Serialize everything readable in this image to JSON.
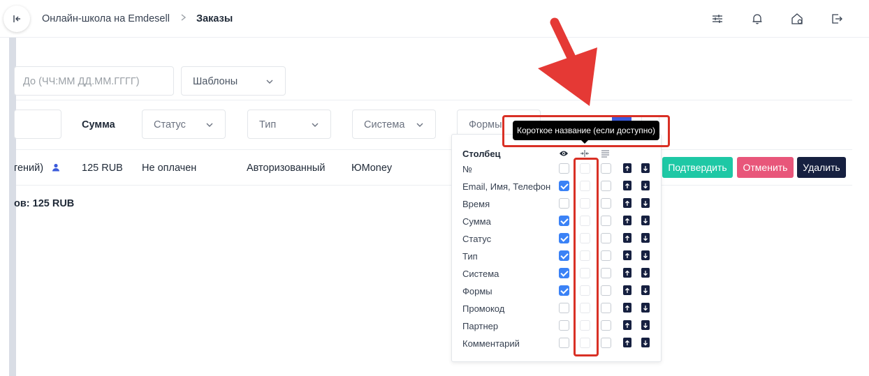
{
  "header": {
    "breadcrumb_root": "Онлайн-школа на Emdesell",
    "breadcrumb_current": "Заказы"
  },
  "filters": {
    "to_placeholder": "До (ЧЧ:ММ ДД.ММ.ГГГГ)",
    "templates_label": "Шаблоны"
  },
  "columns": {
    "sum": "Сумма",
    "status": "Статус",
    "type": "Тип",
    "system": "Система",
    "forms": "Формы"
  },
  "order_row": {
    "name_fragment": "гений)",
    "sum": "125 RUB",
    "status": "Не оплачен",
    "type": "Авторизованный",
    "system": "ЮMoney"
  },
  "actions": {
    "confirm": "Подтвердить",
    "cancel": "Отменить",
    "delete": "Удалить"
  },
  "colors": {
    "confirm": "#1ec8a5",
    "cancel": "#e8567a",
    "delete": "#162040",
    "checkbox_on": "#3b82f6",
    "annotation": "#d93025"
  },
  "total_text": "ов: 125 RUB",
  "tooltip_text": "Короткое название (если доступно)",
  "column_menu": {
    "header": "Столбец",
    "rows": [
      {
        "label": "№",
        "visible": false
      },
      {
        "label": "Email, Имя, Телефон",
        "visible": true
      },
      {
        "label": "Время",
        "visible": false
      },
      {
        "label": "Сумма",
        "visible": true
      },
      {
        "label": "Статус",
        "visible": true
      },
      {
        "label": "Тип",
        "visible": true
      },
      {
        "label": "Система",
        "visible": true
      },
      {
        "label": "Формы",
        "visible": true
      },
      {
        "label": "Промокод",
        "visible": false
      },
      {
        "label": "Партнер",
        "visible": false
      },
      {
        "label": "Комментарий",
        "visible": false
      }
    ]
  }
}
